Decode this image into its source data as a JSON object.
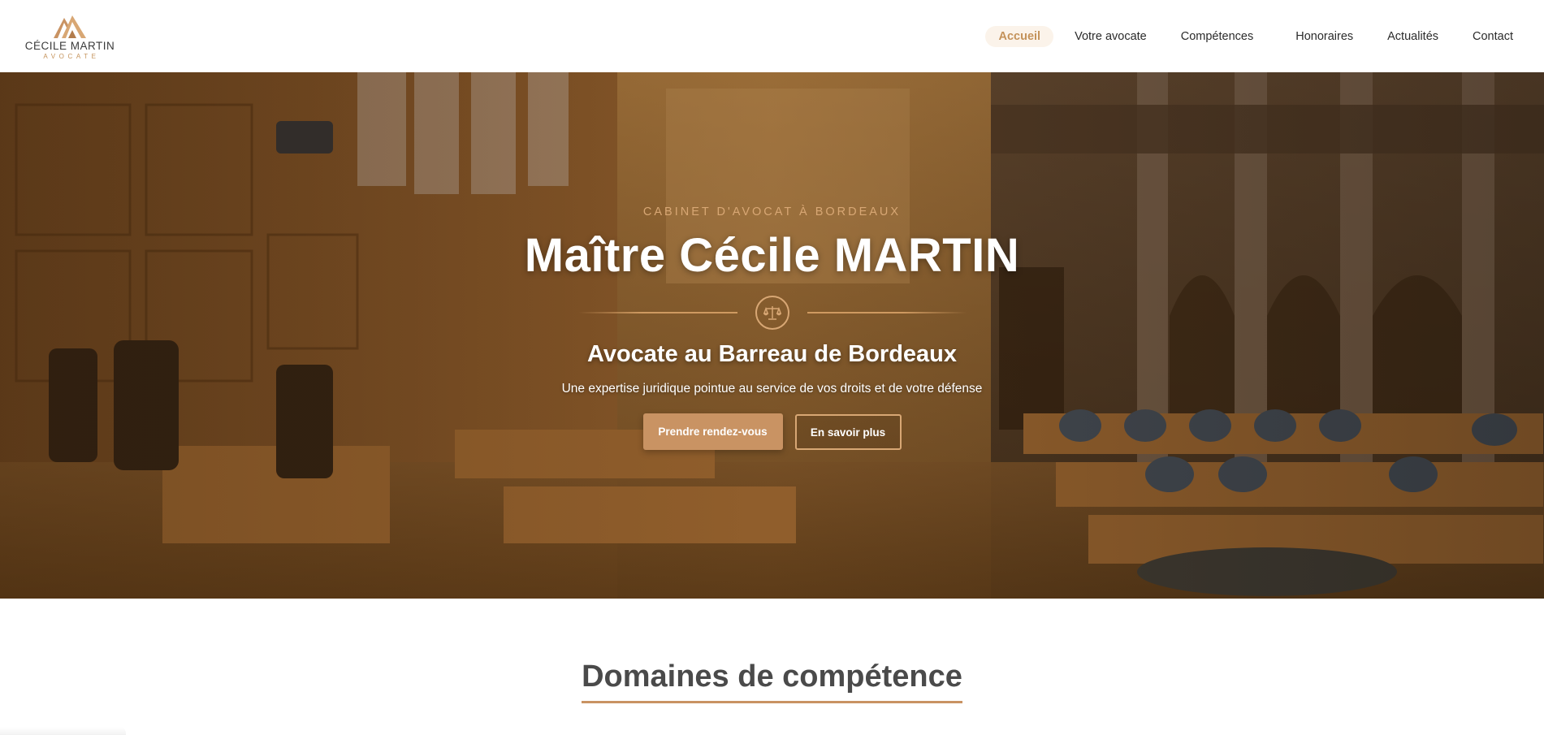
{
  "logo": {
    "name": "CÉCILE MARTIN",
    "subtitle": "AVOCATE",
    "icon": "mountain-monogram-icon"
  },
  "nav": {
    "items": [
      {
        "label": "Accueil",
        "active": true
      },
      {
        "label": "Votre avocate",
        "active": false
      },
      {
        "label": "Compétences",
        "active": false
      },
      {
        "label": "Honoraires",
        "active": false
      },
      {
        "label": "Actualités",
        "active": false
      },
      {
        "label": "Contact",
        "active": false
      }
    ]
  },
  "hero": {
    "eyebrow": "CABINET D'AVOCAT À BORDEAUX",
    "title": "Maître Cécile MARTIN",
    "divider_icon": "scales-of-justice-icon",
    "subtitle": "Avocate au Barreau de Bordeaux",
    "tagline": "Une expertise juridique pointue au service de vos droits et de votre défense",
    "primary_cta": "Prendre rendez-vous",
    "secondary_cta": "En savoir plus",
    "background": "courtroom-photo"
  },
  "section": {
    "title": "Domaines de compétence"
  },
  "colors": {
    "accent": "#c99363",
    "accent_light": "#d8a774",
    "nav_active_bg": "#fbf3ea",
    "heading": "#4a4a4a"
  }
}
